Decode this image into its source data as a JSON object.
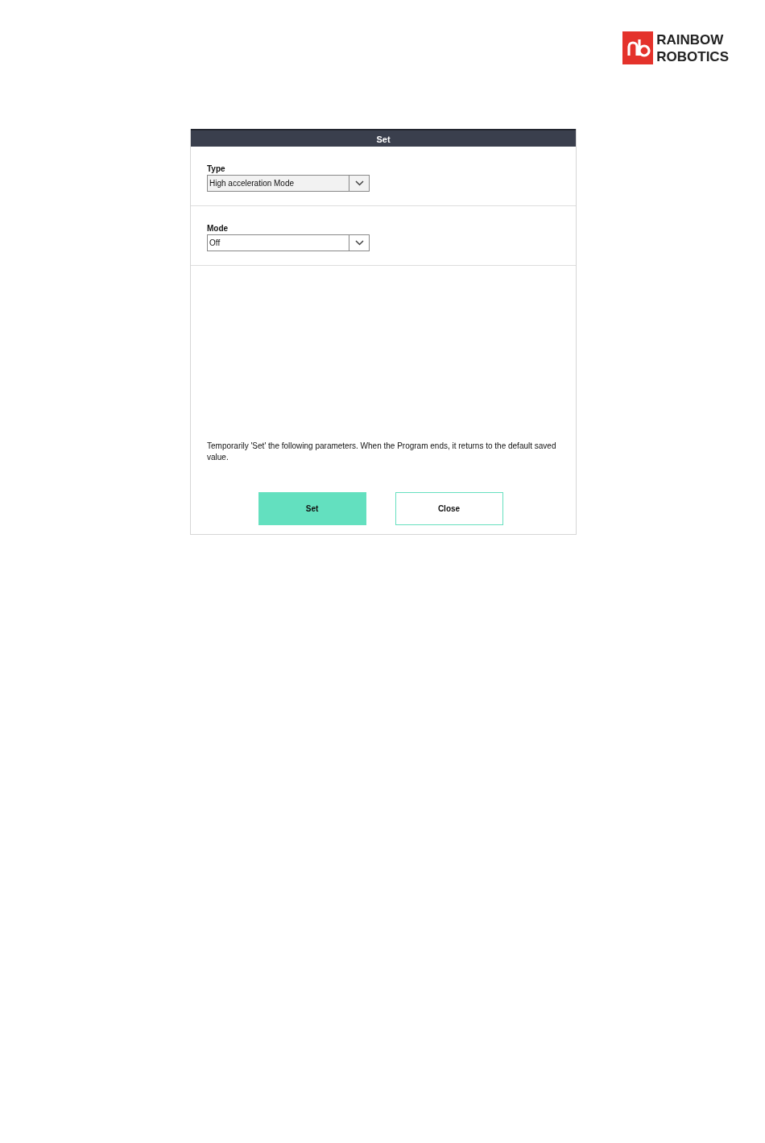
{
  "logo": {
    "line_1": "RAINBOW",
    "line_2": "ROBOTICS"
  },
  "dialog": {
    "title": "Set",
    "fields": [
      {
        "label": "Type",
        "value": "High acceleration Mode",
        "disabled": true
      },
      {
        "label": "Mode",
        "value": "Off",
        "disabled": false
      }
    ],
    "note": "Temporarily 'Set' the following parameters. When the Program ends, it returns to the default saved value.",
    "buttons": [
      {
        "label": "Set",
        "kind": "primary"
      },
      {
        "label": "Close",
        "kind": "secondary"
      }
    ]
  }
}
